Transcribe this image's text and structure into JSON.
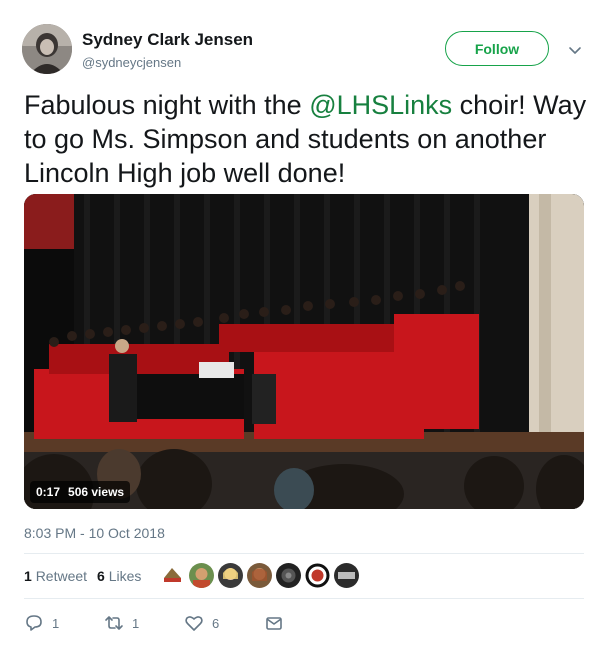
{
  "author": {
    "name": "Sydney Clark Jensen",
    "handle": "@sydneycjensen",
    "follow_label": "Follow"
  },
  "tweet": {
    "text_before_mention": "Fabulous night with the ",
    "mention": "@LHSLinks",
    "text_after_mention": " choir! Way to go Ms. Simpson and students on another Lincoln High job well done!"
  },
  "video": {
    "duration": "0:17",
    "views": "506 views"
  },
  "timestamp": "8:03 PM - 10 Oct 2018",
  "stats": {
    "retweets_count": "1",
    "retweets_label": "Retweet",
    "likes_count": "6",
    "likes_label": "Likes"
  },
  "actions": {
    "reply_count": "1",
    "retweet_count": "1",
    "like_count": "6"
  },
  "colors": {
    "accent": "#17a34a",
    "mention": "#17803f",
    "muted": "#657786"
  }
}
